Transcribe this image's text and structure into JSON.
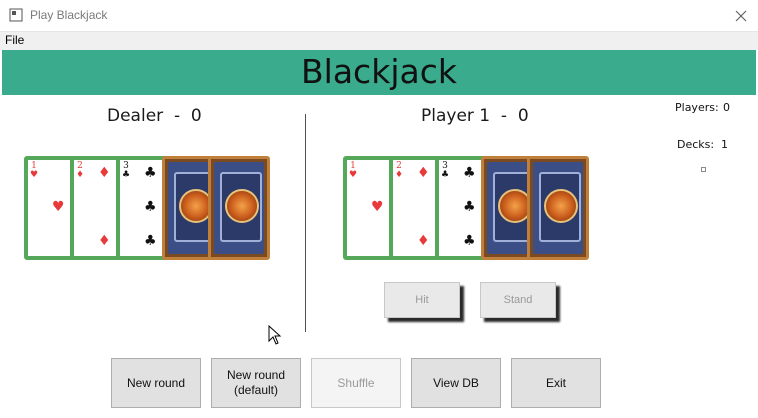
{
  "window": {
    "title": "Play Blackjack"
  },
  "menu": {
    "file": "File"
  },
  "banner": {
    "title": "Blackjack"
  },
  "dealer": {
    "heading": "Dealer  -  0",
    "cards": [
      {
        "rank": "1",
        "suit": "heart",
        "face_up": true
      },
      {
        "rank": "2",
        "suit": "diamond",
        "face_up": true
      },
      {
        "rank": "3",
        "suit": "club",
        "face_up": true
      },
      {
        "face_up": false
      },
      {
        "face_up": false
      }
    ]
  },
  "player": {
    "heading": "Player 1  -  0",
    "cards": [
      {
        "rank": "1",
        "suit": "heart",
        "face_up": true
      },
      {
        "rank": "2",
        "suit": "diamond",
        "face_up": true
      },
      {
        "rank": "3",
        "suit": "club",
        "face_up": true
      },
      {
        "face_up": false
      },
      {
        "face_up": false
      }
    ]
  },
  "side_panel": {
    "players_label": "Players:",
    "players_count": "0",
    "decks_label": "Decks:",
    "decks_count": "1"
  },
  "actions": {
    "hit": "Hit",
    "stand": "Stand"
  },
  "buttons": {
    "new_round": "New round",
    "new_round_default_line1": "New round",
    "new_round_default_line2": "(default)",
    "shuffle": "Shuffle",
    "view_db": "View DB",
    "exit": "Exit"
  },
  "colors": {
    "banner": "#3aab8c",
    "card_border": "#55a85a",
    "red_suit": "#e83a3a",
    "black_suit": "#111111"
  }
}
